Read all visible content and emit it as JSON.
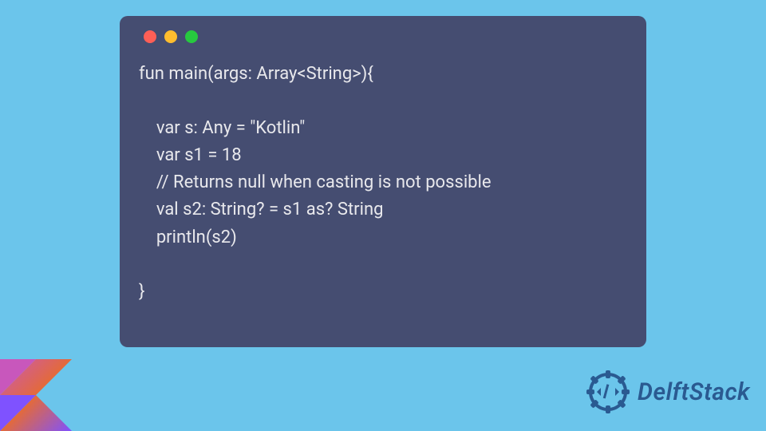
{
  "code": {
    "lines": [
      "fun main(args: Array<String>){",
      "",
      "    var s: Any = \"Kotlin\"",
      "    var s1 = 18",
      "    // Returns null when casting is not possible",
      "    val s2: String? = s1 as? String",
      "    println(s2)",
      "",
      "}"
    ]
  },
  "brand": {
    "name": "DelftStack"
  },
  "colors": {
    "background": "#6bc5eb",
    "window": "#454d71",
    "text": "#e8e8ec",
    "brand_text": "#2a5a91",
    "red": "#ff5f56",
    "yellow": "#ffbd2e",
    "green": "#27c93f"
  }
}
